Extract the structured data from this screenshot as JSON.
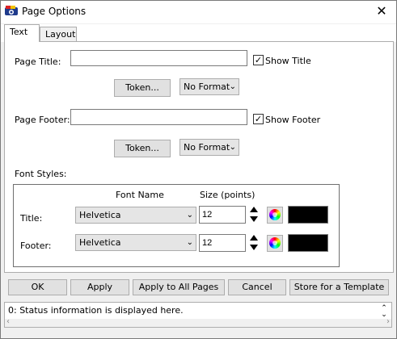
{
  "window": {
    "title": "Page Options",
    "close_glyph": "✕"
  },
  "tabs": [
    {
      "label": "Text",
      "active": true
    },
    {
      "label": "Layout",
      "active": false
    }
  ],
  "page_title": {
    "label": "Page Title:",
    "value": "",
    "show_label": "Show Title",
    "show_checked": true,
    "token_button": "Token...",
    "format": "No Format"
  },
  "page_footer": {
    "label": "Page Footer:",
    "value": "",
    "show_label": "Show Footer",
    "show_checked": true,
    "token_button": "Token...",
    "format": "No Format"
  },
  "font_styles": {
    "label": "Font Styles:",
    "col_font_name": "Font Name",
    "col_size": "Size (points)",
    "rows": [
      {
        "label": "Title:",
        "font": "Helvetica",
        "size": "12",
        "color": "#000000"
      },
      {
        "label": "Footer:",
        "font": "Helvetica",
        "size": "12",
        "color": "#000000"
      }
    ]
  },
  "buttons": {
    "ok": "OK",
    "apply": "Apply",
    "apply_all": "Apply to All Pages",
    "cancel": "Cancel",
    "store_template": "Store for a Template"
  },
  "status": {
    "text": "0: Status information is displayed here."
  },
  "icons": {
    "app": "app-icon",
    "close": "close-icon",
    "checkbox_check": "✓",
    "dropdown": "chevron-down-icon",
    "color_picker": "color-wheel-icon"
  }
}
